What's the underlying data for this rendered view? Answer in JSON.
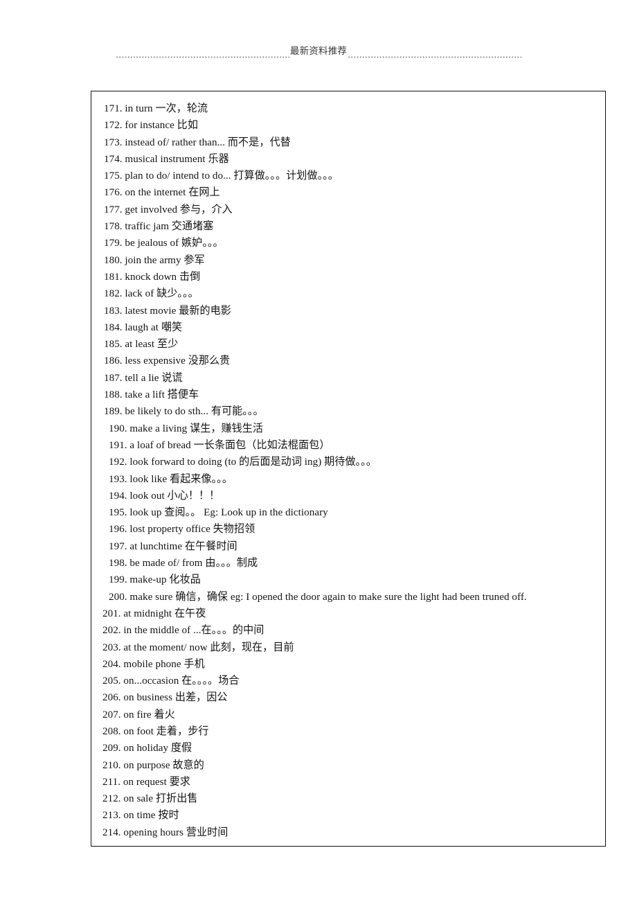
{
  "header": {
    "title": "最新资料推荐",
    "left_leader": "dotted-leader",
    "right_leader": "dotted-leader"
  },
  "document": {
    "entries": [
      {
        "number": "171.",
        "text": "171. in turn      一次，轮流",
        "indent": "a"
      },
      {
        "number": "172.",
        "text": "172. for instance     比如",
        "indent": "a"
      },
      {
        "number": "173.",
        "text": "173. instead of/ rather than...     而不是，代替",
        "indent": "a"
      },
      {
        "number": "174.",
        "text": "174. musical instrument     乐器",
        "indent": "a"
      },
      {
        "number": "175.",
        "text": "175. plan to do/ intend to do...   打算做。。。计划做。。。",
        "indent": "a"
      },
      {
        "number": "176.",
        "text": "176. on the internet       在网上",
        "indent": "a"
      },
      {
        "number": "177.",
        "text": "177. get involved   参与，介入",
        "indent": "a"
      },
      {
        "number": "178.",
        "text": "178. traffic jam     交通堵塞",
        "indent": "a"
      },
      {
        "number": "179.",
        "text": "179. be jealous of     嫉妒。。。",
        "indent": "a"
      },
      {
        "number": "180.",
        "text": "180. join the army      参军",
        "indent": "a"
      },
      {
        "number": "181.",
        "text": "181. knock down      击倒",
        "indent": "a"
      },
      {
        "number": "182.",
        "text": "182. lack of    缺少。。。",
        "indent": "a"
      },
      {
        "number": "183.",
        "text": "183. latest movie    最新的电影",
        "indent": "a"
      },
      {
        "number": "184.",
        "text": "184. laugh at     嘲笑",
        "indent": "a"
      },
      {
        "number": "185.",
        "text": "185. at least     至少",
        "indent": "a"
      },
      {
        "number": "186.",
        "text": "186. less expensive     没那么贵",
        "indent": "a"
      },
      {
        "number": "187.",
        "text": "187. tell a lie     说谎",
        "indent": "a"
      },
      {
        "number": "188.",
        "text": "188. take a lift     搭便车",
        "indent": "a"
      },
      {
        "number": "189.",
        "text": "189. be likely to do sth...   有可能。。。",
        "indent": "a"
      },
      {
        "number": "190.",
        "text": "190. make a living     谋生，赚钱生活",
        "indent": "b"
      },
      {
        "number": "191.",
        "text": "191. a loaf of bread     一长条面包（比如法棍面包）",
        "indent": "b"
      },
      {
        "number": "192.",
        "text": "192. look forward to doing (to  的后面是动词 ing)   期待做。。。",
        "indent": "b"
      },
      {
        "number": "193.",
        "text": "193. look like     看起来像。。。",
        "indent": "b"
      },
      {
        "number": "194.",
        "text": "194. look out     小心！！！",
        "indent": "b"
      },
      {
        "number": "195.",
        "text": "195. look up     查阅。。  Eg: Look up in the dictionary",
        "indent": "b"
      },
      {
        "number": "196.",
        "text": "196. lost property office   失物招领",
        "indent": "b"
      },
      {
        "number": "197.",
        "text": "197. at lunchtime  在午餐时间",
        "indent": "b"
      },
      {
        "number": "198.",
        "text": "198. be made of/ from  由。。。制成",
        "indent": "b"
      },
      {
        "number": "199.",
        "text": "199. make-up  化妆品",
        "indent": "b"
      },
      {
        "number": "200.",
        "text": "200. make sure  确信，确保  eg: I opened the door again to make sure the light had been truned off.",
        "indent": "b"
      },
      {
        "number": "201.",
        "text": "201. at midnight 在午夜",
        "indent": "c"
      },
      {
        "number": "202.",
        "text": "202. in the middle of ...在。。。的中间",
        "indent": "c"
      },
      {
        "number": "203.",
        "text": "203. at the moment/ now  此刻，现在，目前",
        "indent": "c"
      },
      {
        "number": "204.",
        "text": "204. mobile phone  手机",
        "indent": "c"
      },
      {
        "number": "205.",
        "text": "205. on...occasion  在。。。。场合",
        "indent": "c"
      },
      {
        "number": "206.",
        "text": "206. on business  出差，因公",
        "indent": "c"
      },
      {
        "number": "207.",
        "text": "207. on fire  着火",
        "indent": "c"
      },
      {
        "number": "208.",
        "text": "208. on foot  走着，步行",
        "indent": "c"
      },
      {
        "number": "209.",
        "text": "209. on holiday  度假",
        "indent": "c"
      },
      {
        "number": "210.",
        "text": "210. on purpose  故意的",
        "indent": "c"
      },
      {
        "number": "211.",
        "text": "211. on request  要求",
        "indent": "c"
      },
      {
        "number": "212.",
        "text": "212. on sale  打折出售",
        "indent": "c"
      },
      {
        "number": "213.",
        "text": "213. on time  按时",
        "indent": "c"
      },
      {
        "number": "214.",
        "text": "214. opening hours  营业时间",
        "indent": "c"
      }
    ]
  }
}
